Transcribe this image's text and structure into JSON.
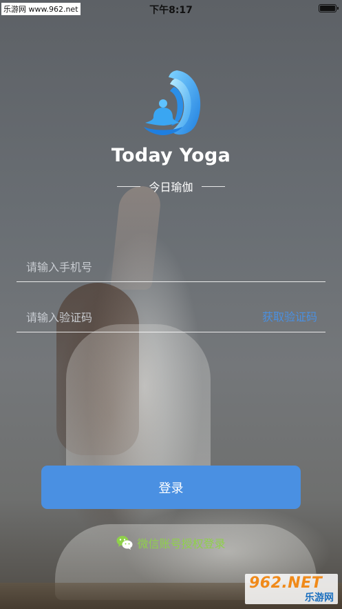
{
  "status_bar": {
    "source_tag": "乐游网 www.962.net",
    "time": "下午8:17"
  },
  "branding": {
    "logo_icon": "yoga-meditation-logo-icon",
    "app_title": "Today Yoga",
    "subtitle": "今日瑜伽"
  },
  "form": {
    "phone_placeholder": "请输入手机号",
    "code_placeholder": "请输入验证码",
    "get_code_label": "获取验证码"
  },
  "actions": {
    "login_label": "登录",
    "wechat_label": "微信账号授权登录",
    "wechat_icon": "wechat-icon"
  },
  "watermark": {
    "top": "962.NET",
    "bottom": "乐游网"
  },
  "colors": {
    "accent": "#4a90e2",
    "wechat_green": "#8fd14a"
  }
}
